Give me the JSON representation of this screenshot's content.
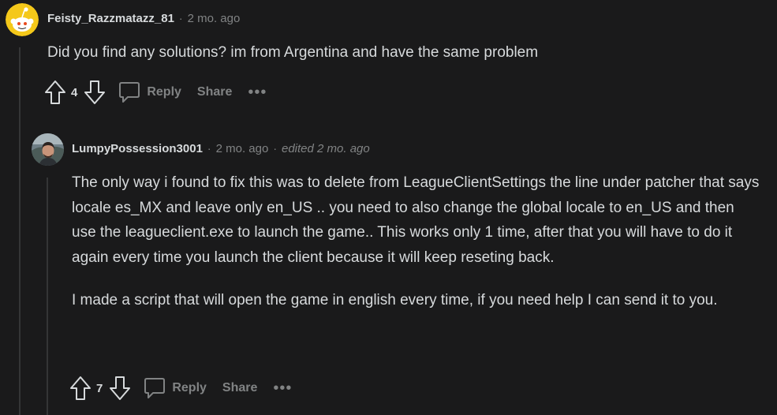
{
  "comment1": {
    "author": "Feisty_Razzmatazz_81",
    "time": "2 mo. ago",
    "body": "Did you find any solutions? im from Argentina and have the same problem",
    "score": "4",
    "reply_label": "Reply",
    "share_label": "Share",
    "more_label": "•••"
  },
  "comment2": {
    "author": "LumpyPossession3001",
    "time": "2 mo. ago",
    "edited": "edited 2 mo. ago",
    "paragraphs": [
      "The only way i found to fix this was to delete from LeagueClientSettings the line under patcher that says locale es_MX and leave only en_US .. you need to also change the global locale to en_US and then use the leagueclient.exe to launch the game.. This works only 1 time, after that you will have to do it again every time you launch the client because it will keep reseting back.",
      "I made a script that will open the game in english every time, if you need help I can send it to you."
    ],
    "score": "7",
    "reply_label": "Reply",
    "share_label": "Share",
    "more_label": "•••"
  },
  "separator": "·",
  "colors": {
    "background": "#1a1a1b",
    "text": "#d7dadc",
    "muted": "#818384",
    "thread_line": "#343536",
    "avatar1": "#f4c81a"
  },
  "icons": {
    "avatar1": "snoo-avatar-icon",
    "avatar2": "user-photo-avatar",
    "upvote": "upvote-arrow-icon",
    "downvote": "downvote-arrow-icon",
    "reply": "speech-bubble-icon"
  }
}
